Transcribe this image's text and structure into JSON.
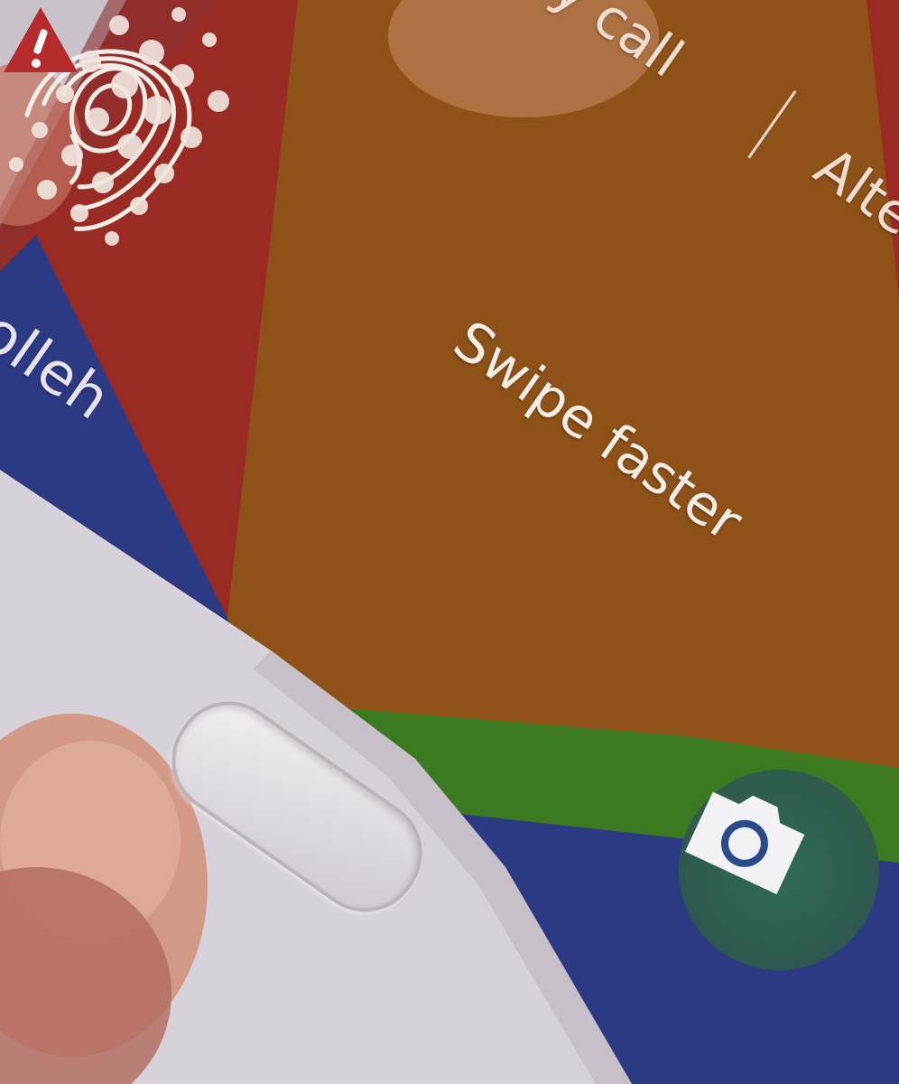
{
  "lock_screen": {
    "carrier_label": "olleh",
    "emergency_label": "y call",
    "alternate_label": "Alte",
    "fingerprint_status": "Swipe faster"
  },
  "colors": {
    "background_red": "#9a2a24",
    "center_orange": "#8e5218",
    "carrier_blue": "#2c3a84",
    "green_band": "#3c7a22",
    "phone_white": "#d7d2da"
  },
  "icons": {
    "fingerprint": "fingerprint-icon",
    "alert": "alert-triangle-icon",
    "camera": "camera-icon",
    "unlock_effect": "dot-pattern"
  }
}
